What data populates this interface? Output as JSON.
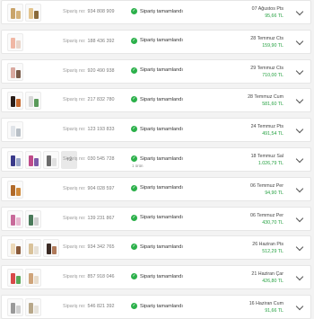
{
  "order_no_label": "Sipariş no:",
  "status_label": "Sipariş tamamlandı",
  "icons": {
    "status": "check-circle-icon",
    "expand": "chevron-down-icon"
  },
  "colors": {
    "status_green": "#2bb04a",
    "price_green": "#27a243"
  },
  "orders": [
    {
      "number": "934 808 909",
      "date": "07 Ağustos Pts",
      "price": "95,66 TL",
      "status_note": "",
      "more_count": "",
      "thumbs": [
        [
          "#c9a46a",
          "#d4b27a"
        ],
        [
          "#e2c48e",
          "#8a6a3a"
        ]
      ]
    },
    {
      "number": "188 436 392",
      "date": "28 Temmuz Cts",
      "price": "159,90 TL",
      "status_note": "",
      "more_count": "",
      "thumbs": [
        [
          "#f0b7a4",
          "#e9d4c8"
        ]
      ]
    },
    {
      "number": "920 490 938",
      "date": "29 Temmuz Cts",
      "price": "710,00 TL",
      "status_note": "",
      "more_count": "",
      "thumbs": [
        [
          "#d9a9a0",
          "#7a5b49"
        ]
      ]
    },
    {
      "number": "217 832 780",
      "date": "28 Temmuz Cum",
      "price": "581,60 TL",
      "status_note": "",
      "more_count": "",
      "thumbs": [
        [
          "#2a1d18",
          "#c76a2f"
        ],
        [
          "#d8d8d8",
          "#5a9a5a"
        ]
      ]
    },
    {
      "number": "123 193 833",
      "date": "24 Temmuz Pts",
      "price": "491,54 TL",
      "status_note": "",
      "more_count": "",
      "thumbs": [
        [
          "#dfe3e8",
          "#b9c0c7"
        ]
      ]
    },
    {
      "number": "030 545 728",
      "date": "18 Temmuz Sal",
      "price": "1.026,79 TL",
      "status_note": "1 ürün",
      "more_count": "+2",
      "thumbs": [
        [
          "#3a3a8a",
          "#9aa6c8"
        ],
        [
          "#c04b8a",
          "#7c5aa8"
        ],
        [
          "#6c6c6c",
          "#e0e0e0"
        ]
      ]
    },
    {
      "number": "904 028 597",
      "date": "06 Temmuz Per",
      "price": "94,90 TL",
      "status_note": "",
      "more_count": "",
      "thumbs": [
        [
          "#b06a2a",
          "#d08a3a"
        ]
      ]
    },
    {
      "number": "139 231 867",
      "date": "06 Temmuz Per",
      "price": "430,70 TL",
      "status_note": "",
      "more_count": "",
      "thumbs": [
        [
          "#c86a9a",
          "#e8b8d0"
        ],
        [
          "#4a7a5a",
          "#cfcfcf"
        ]
      ]
    },
    {
      "number": "934 342 765",
      "date": "26 Haziran Pts",
      "price": "512,29 TL",
      "status_note": "",
      "more_count": "",
      "thumbs": [
        [
          "#ecd8b8",
          "#8a5a3a"
        ],
        [
          "#d9c29a",
          "#e6e0d6"
        ],
        [
          "#3a2a24",
          "#b07a5a"
        ]
      ]
    },
    {
      "number": "857 918 046",
      "date": "21 Haziran Çar",
      "price": "426,80 TL",
      "status_note": "",
      "more_count": "",
      "thumbs": [
        [
          "#d84a4a",
          "#5aa85a"
        ],
        [
          "#cfa47a",
          "#e8dccb"
        ]
      ]
    },
    {
      "number": "546 821 392",
      "date": "16 Haziran Cum",
      "price": "91,66 TL",
      "status_note": "",
      "more_count": "",
      "thumbs": [
        [
          "#9a9a9a",
          "#d0d0d0"
        ],
        [
          "#b8a88a",
          "#e6e2da"
        ]
      ]
    }
  ]
}
